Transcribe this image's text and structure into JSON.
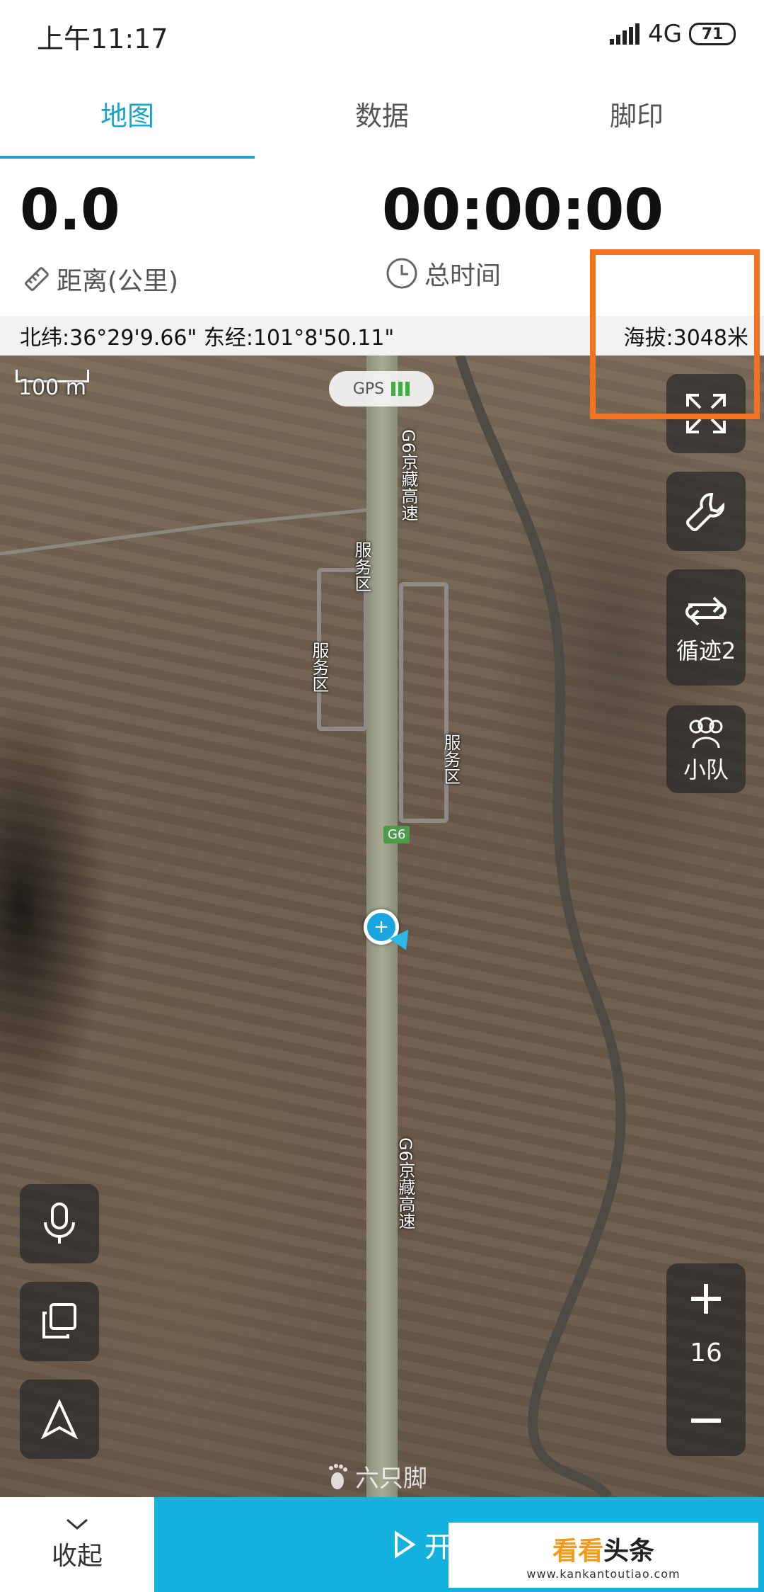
{
  "status_bar": {
    "time": "上午11:17",
    "network": "4G",
    "battery": "71"
  },
  "tabs": [
    {
      "label": "地图",
      "active": true
    },
    {
      "label": "数据",
      "active": false
    },
    {
      "label": "脚印",
      "active": false
    }
  ],
  "stats": {
    "distance_value": "0.0",
    "distance_label": "距离(公里)",
    "time_value": "00:00:00",
    "time_label": "总时间"
  },
  "coords": {
    "latlon": "北纬:36°29'9.66\" 东经:101°8'50.11\"",
    "altitude": "海拔:3048米"
  },
  "map": {
    "scale_label": "100 m",
    "gps_label": "GPS",
    "road_labels": [
      "G6京藏高速",
      "服务区",
      "服务区",
      "服务区",
      "G6",
      "G6京藏高速"
    ],
    "watermark": "六只脚",
    "zoom_level": "16"
  },
  "controls": {
    "track_label": "循迹2",
    "team_label": "小队"
  },
  "bottom": {
    "collapse_label": "收起",
    "start_label": "开",
    "brand_text_1": "看看",
    "brand_text_2": "头条",
    "brand_url": "www.kankantoutiao.com"
  },
  "colors": {
    "accent": "#1aa5c8",
    "start_button": "#15b1de",
    "highlight": "#f27420"
  }
}
